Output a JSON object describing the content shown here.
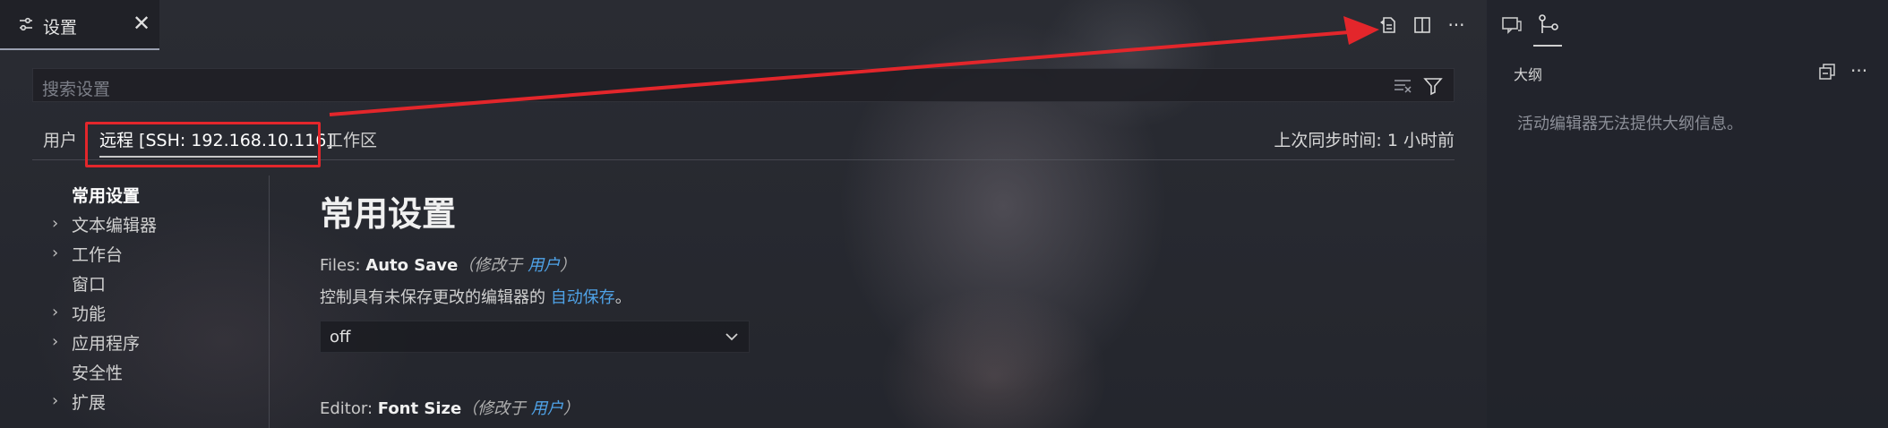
{
  "tab": {
    "title": "设置",
    "close": "✕"
  },
  "search": {
    "placeholder": "搜索设置"
  },
  "scopes": {
    "user": "用户",
    "remote": "远程 [SSH: 192.168.10.116]",
    "workspace": "工作区",
    "sync": "上次同步时间: 1 小时前"
  },
  "toc": [
    {
      "label": "常用设置",
      "expandable": false,
      "active": true
    },
    {
      "label": "文本编辑器",
      "expandable": true
    },
    {
      "label": "工作台",
      "expandable": true
    },
    {
      "label": "窗口",
      "expandable": false
    },
    {
      "label": "功能",
      "expandable": true
    },
    {
      "label": "应用程序",
      "expandable": true
    },
    {
      "label": "安全性",
      "expandable": false
    },
    {
      "label": "扩展",
      "expandable": true
    }
  ],
  "content": {
    "section_title": "常用设置",
    "autosave": {
      "prefix": "Files: ",
      "name": "Auto Save",
      "modified_open": "（修改于 ",
      "modified_link": "用户",
      "modified_close": "）",
      "desc_before": "控制具有未保存更改的编辑器的 ",
      "desc_link": "自动保存",
      "desc_after": "。",
      "value": "off"
    },
    "fontsize": {
      "prefix": "Editor: ",
      "name": "Font Size",
      "modified_open": "（修改于 ",
      "modified_link": "用户",
      "modified_close": "）"
    }
  },
  "outline": {
    "header": "大纲",
    "empty": "活动编辑器无法提供大纲信息。",
    "more": "···"
  },
  "actions": {
    "more": "···"
  },
  "colors": {
    "accent_red": "#e3262b",
    "link": "#4fa3e8"
  },
  "icons": [
    "settings-icon",
    "close-icon",
    "open-settings-json-icon",
    "split-editor-icon",
    "more-actions-icon",
    "clear-search-icon",
    "filter-icon",
    "chevron-right-icon",
    "chevron-down-icon",
    "chat-icon",
    "source-control-icon",
    "collapse-all-icon"
  ]
}
